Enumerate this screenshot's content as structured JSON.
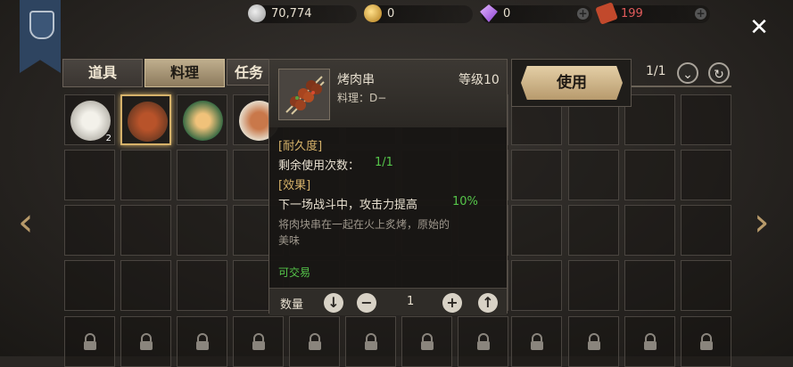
{
  "currencies": [
    {
      "name": "silver-coin-icon",
      "value": "70,774",
      "color": "#c0c0c0"
    },
    {
      "name": "gold-coin-icon",
      "value": "0",
      "color": "#d7a33a"
    },
    {
      "name": "diamond-icon",
      "value": "0",
      "color": "#b46be3"
    },
    {
      "name": "ticket-icon",
      "value": "199",
      "color": "#d45a3a"
    }
  ],
  "tabs": {
    "items": [
      "道具",
      "料理",
      "任务"
    ],
    "active": "料理"
  },
  "page": "1/1",
  "grid": {
    "first_count": "2"
  },
  "tooltip": {
    "name": "烤肉串",
    "level": "等级10",
    "type": "料理：D−",
    "durability_header": "[耐久度]",
    "uses_label": "剩余使用次数：",
    "uses_value": "1/1",
    "effect_header": "[效果]",
    "effect_text": "下一场战斗中，攻击力提高",
    "effect_value": "10%",
    "description_line1": "将肉块串在一起在火上炙烤，原始的",
    "description_line2": "美味",
    "tradeable": "可交易",
    "quantity_label": "数量",
    "quantity_value": "1"
  },
  "use_button": "使用",
  "colors": {
    "green": "#55c54a",
    "gold": "#d6b26a",
    "accent_red": "#e05b5b"
  }
}
